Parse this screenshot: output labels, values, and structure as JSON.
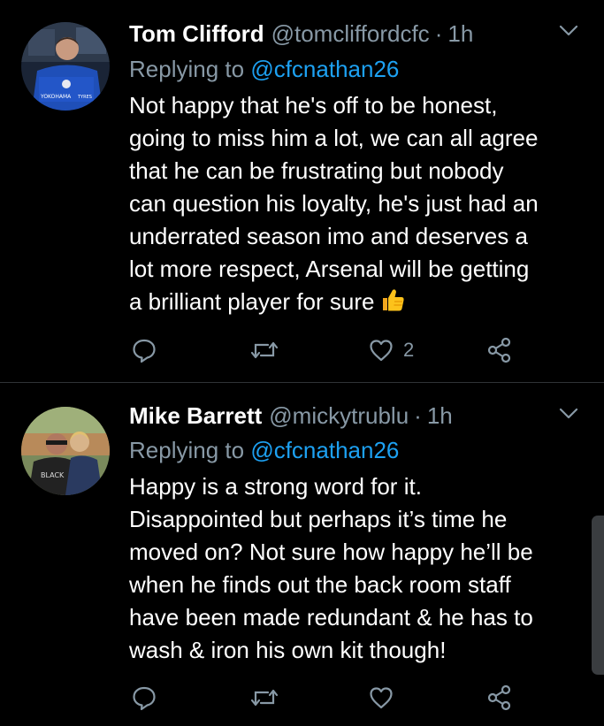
{
  "tweets": [
    {
      "display_name": "Tom Clifford",
      "handle": "@tomcliffordcfc",
      "separator": "·",
      "time": "1h",
      "replying_prefix": "Replying to",
      "replying_to": "@cfcnathan26",
      "body_lines": [
        "Not happy that he's off to be honest,",
        "going to miss him a lot, we can all agree",
        "that he can be frustrating but nobody",
        "can question his loyalty, he's just had an",
        "underrated season imo and deserves a",
        "lot more respect, Arsenal will be getting",
        "a brilliant player for sure"
      ],
      "emoji": "thumbs-up",
      "like_count": "2",
      "avatar_text": "YOKOHAMA TYRES"
    },
    {
      "display_name": "Mike Barrett",
      "handle": "@mickytrublu",
      "separator": "·",
      "time": "1h",
      "replying_prefix": "Replying to",
      "replying_to": "@cfcnathan26",
      "body_lines": [
        "Happy is a strong word for it.",
        "Disappointed but perhaps it’s time he",
        "moved on? Not sure how happy he’ll be",
        "when he finds out the back room staff",
        "have been made redundant & he has to",
        "wash & iron his own kit though!"
      ],
      "like_count": "",
      "avatar_text": "BLACK"
    }
  ],
  "icons": [
    "reply-icon",
    "retweet-icon",
    "like-icon",
    "share-icon",
    "caret-down-icon"
  ],
  "colors": {
    "background": "#000000",
    "text": "#ffffff",
    "secondary": "#8899a6",
    "link": "#1da1f2",
    "divider": "#2f3336"
  }
}
